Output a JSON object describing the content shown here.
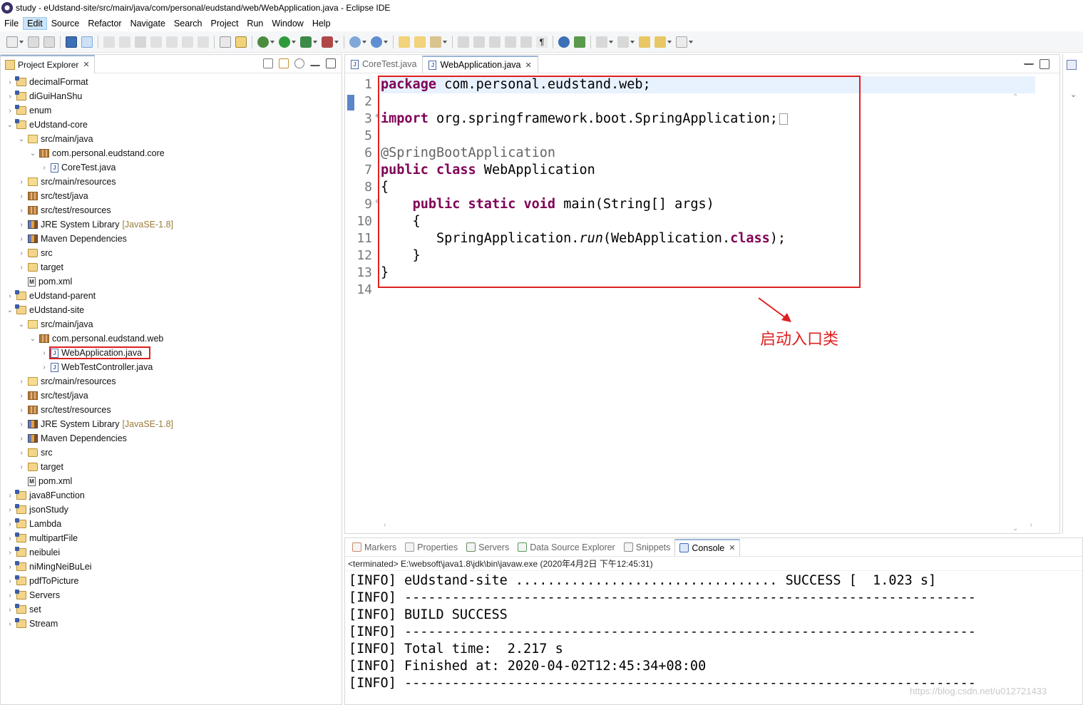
{
  "window": {
    "title": "study - eUdstand-site/src/main/java/com/personal/eudstand/web/WebApplication.java - Eclipse IDE"
  },
  "menu": [
    "File",
    "Edit",
    "Source",
    "Refactor",
    "Navigate",
    "Search",
    "Project",
    "Run",
    "Window",
    "Help"
  ],
  "project_explorer": {
    "tab_label": "Project Explorer",
    "close_glyph": "✕",
    "tree": [
      {
        "label": "decimalFormat",
        "icon": "project-icon",
        "depth": 0,
        "expanded": false
      },
      {
        "label": "diGuiHanShu",
        "icon": "project-icon",
        "depth": 0,
        "expanded": false
      },
      {
        "label": "enum",
        "icon": "project-icon",
        "depth": 0,
        "expanded": false
      },
      {
        "label": "eUdstand-core",
        "icon": "project-icon",
        "depth": 0,
        "expanded": true
      },
      {
        "label": "src/main/java",
        "icon": "source-folder-icon",
        "depth": 1,
        "expanded": true
      },
      {
        "label": "com.personal.eudstand.core",
        "icon": "package-icon",
        "depth": 2,
        "expanded": true
      },
      {
        "label": "CoreTest.java",
        "icon": "java-file-icon",
        "depth": 3,
        "expanded": false
      },
      {
        "label": "src/main/resources",
        "icon": "source-folder-icon",
        "depth": 1,
        "expanded": false
      },
      {
        "label": "src/test/java",
        "icon": "package-icon",
        "depth": 1,
        "expanded": false
      },
      {
        "label": "src/test/resources",
        "icon": "package-icon",
        "depth": 1,
        "expanded": false
      },
      {
        "label": "JRE System Library",
        "decoration": "[JavaSE-1.8]",
        "icon": "library-icon",
        "depth": 1,
        "expanded": false
      },
      {
        "label": "Maven Dependencies",
        "icon": "library-icon",
        "depth": 1,
        "expanded": false
      },
      {
        "label": "src",
        "icon": "folder-icon",
        "depth": 1,
        "expanded": false
      },
      {
        "label": "target",
        "icon": "folder-icon",
        "depth": 1,
        "expanded": false
      },
      {
        "label": "pom.xml",
        "icon": "xml-file-icon",
        "depth": 1,
        "leaf": true
      },
      {
        "label": "eUdstand-parent",
        "icon": "project-icon",
        "depth": 0,
        "expanded": false
      },
      {
        "label": "eUdstand-site",
        "icon": "project-icon",
        "depth": 0,
        "expanded": true
      },
      {
        "label": "src/main/java",
        "icon": "source-folder-icon",
        "depth": 1,
        "expanded": true
      },
      {
        "label": "com.personal.eudstand.web",
        "icon": "package-icon",
        "depth": 2,
        "expanded": true
      },
      {
        "label": "WebApplication.java",
        "icon": "java-file-icon",
        "depth": 3,
        "expanded": false,
        "highlighted": true
      },
      {
        "label": "WebTestController.java",
        "icon": "java-file-icon",
        "depth": 3,
        "expanded": false
      },
      {
        "label": "src/main/resources",
        "icon": "source-folder-icon",
        "depth": 1,
        "expanded": false
      },
      {
        "label": "src/test/java",
        "icon": "package-icon",
        "depth": 1,
        "expanded": false
      },
      {
        "label": "src/test/resources",
        "icon": "package-icon",
        "depth": 1,
        "expanded": false
      },
      {
        "label": "JRE System Library",
        "decoration": "[JavaSE-1.8]",
        "icon": "library-icon",
        "depth": 1,
        "expanded": false
      },
      {
        "label": "Maven Dependencies",
        "icon": "library-icon",
        "depth": 1,
        "expanded": false
      },
      {
        "label": "src",
        "icon": "folder-icon",
        "depth": 1,
        "expanded": false
      },
      {
        "label": "target",
        "icon": "folder-icon",
        "depth": 1,
        "expanded": false
      },
      {
        "label": "pom.xml",
        "icon": "xml-file-icon",
        "depth": 1,
        "leaf": true
      },
      {
        "label": "java8Function",
        "icon": "project-icon",
        "depth": 0,
        "expanded": false
      },
      {
        "label": "jsonStudy",
        "icon": "project-icon",
        "depth": 0,
        "expanded": false
      },
      {
        "label": "Lambda",
        "icon": "project-icon",
        "depth": 0,
        "expanded": false
      },
      {
        "label": "multipartFile",
        "icon": "project-icon",
        "depth": 0,
        "expanded": false
      },
      {
        "label": "neibulei",
        "icon": "project-icon",
        "depth": 0,
        "expanded": false
      },
      {
        "label": "niMingNeiBuLei",
        "icon": "project-icon",
        "depth": 0,
        "expanded": false
      },
      {
        "label": "pdfToPicture",
        "icon": "project-icon",
        "depth": 0,
        "expanded": false
      },
      {
        "label": "Servers",
        "icon": "project-icon",
        "depth": 0,
        "expanded": false
      },
      {
        "label": "set",
        "icon": "project-icon",
        "depth": 0,
        "expanded": false
      },
      {
        "label": "Stream",
        "icon": "project-icon",
        "depth": 0,
        "expanded": false
      }
    ]
  },
  "editor": {
    "tabs": [
      {
        "label": "CoreTest.java",
        "active": false
      },
      {
        "label": "WebApplication.java",
        "active": true
      }
    ],
    "close_glyph": "✕",
    "line_numbers": [
      "1",
      "2",
      "3",
      "5",
      "6",
      "7",
      "8",
      "9",
      "10",
      "11",
      "12",
      "13",
      "14"
    ],
    "fold_markers": {
      "3": "⊕",
      "9": "⊖"
    },
    "code_lines": [
      [
        {
          "t": "package",
          "c": "kw"
        },
        {
          "t": " com.personal.eudstand.web;"
        }
      ],
      [
        {
          "t": ""
        }
      ],
      [
        {
          "t": "import",
          "c": "kw"
        },
        {
          "t": " org.springframework.boot.SpringApplication;"
        },
        {
          "box": true
        }
      ],
      [
        {
          "t": ""
        }
      ],
      [
        {
          "t": "@SpringBootApplication",
          "c": "an"
        }
      ],
      [
        {
          "t": "public",
          "c": "kw"
        },
        {
          "t": " "
        },
        {
          "t": "class",
          "c": "kw"
        },
        {
          "t": " WebApplication"
        }
      ],
      [
        {
          "t": "{"
        }
      ],
      [
        {
          "t": "    "
        },
        {
          "t": "public",
          "c": "kw"
        },
        {
          "t": " "
        },
        {
          "t": "static",
          "c": "kw"
        },
        {
          "t": " "
        },
        {
          "t": "void",
          "c": "kw"
        },
        {
          "t": " main(String[] args)"
        }
      ],
      [
        {
          "t": "    {"
        }
      ],
      [
        {
          "t": "       SpringApplication."
        },
        {
          "t": "run",
          "c": "it"
        },
        {
          "t": "(WebApplication."
        },
        {
          "t": "class",
          "c": "kw"
        },
        {
          "t": ");"
        }
      ],
      [
        {
          "t": "    }"
        }
      ],
      [
        {
          "t": "}"
        }
      ],
      [
        {
          "t": ""
        }
      ]
    ]
  },
  "annotation": {
    "text": "启动入口类",
    "color": "#e02020"
  },
  "bottom_panel": {
    "tabs": [
      {
        "label": "Markers",
        "active": false,
        "icon": "markers-icon"
      },
      {
        "label": "Properties",
        "active": false,
        "icon": "properties-icon"
      },
      {
        "label": "Servers",
        "active": false,
        "icon": "servers-icon"
      },
      {
        "label": "Data Source Explorer",
        "active": false,
        "icon": "datasource-icon"
      },
      {
        "label": "Snippets",
        "active": false,
        "icon": "snippets-icon"
      },
      {
        "label": "Console",
        "active": true,
        "icon": "console-icon"
      }
    ],
    "close_glyph": "✕",
    "terminated_line": "<terminated> E:\\websoft\\java1.8\\jdk\\bin\\javaw.exe (2020年4月2日 下午12:45:31)",
    "console_lines": [
      "[INFO] eUdstand-site ................................. SUCCESS [  1.023 s]",
      "[INFO] ------------------------------------------------------------------------",
      "[INFO] BUILD SUCCESS",
      "[INFO] ------------------------------------------------------------------------",
      "[INFO] Total time:  2.217 s",
      "[INFO] Finished at: 2020-04-02T12:45:34+08:00",
      "[INFO] ------------------------------------------------------------------------"
    ]
  },
  "watermark": "https://blog.csdn.net/u012721433"
}
